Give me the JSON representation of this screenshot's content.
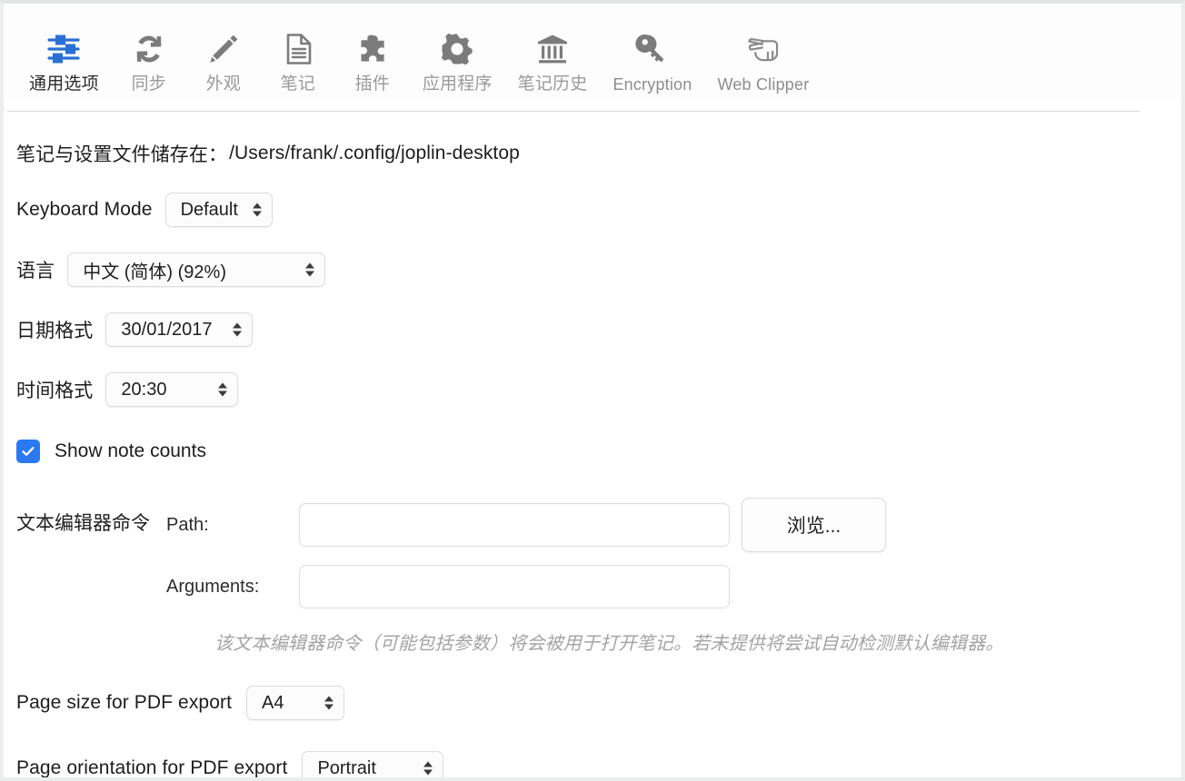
{
  "tabs": [
    {
      "label": "通用选项",
      "icon": "sliders-icon",
      "active": true,
      "latin": false
    },
    {
      "label": "同步",
      "icon": "sync-icon",
      "active": false,
      "latin": false
    },
    {
      "label": "外观",
      "icon": "pencil-icon",
      "active": false,
      "latin": false
    },
    {
      "label": "笔记",
      "icon": "note-icon",
      "active": false,
      "latin": false
    },
    {
      "label": "插件",
      "icon": "puzzle-icon",
      "active": false,
      "latin": false
    },
    {
      "label": "应用程序",
      "icon": "gear-icon",
      "active": false,
      "latin": false
    },
    {
      "label": "笔记历史",
      "icon": "bank-icon",
      "active": false,
      "latin": false
    },
    {
      "label": "Encryption",
      "icon": "key-icon",
      "active": false,
      "latin": true
    },
    {
      "label": "Web Clipper",
      "icon": "hand-scissors-icon",
      "active": false,
      "latin": true
    }
  ],
  "storage": {
    "label": "笔记与设置文件储存在：",
    "path": "/Users/frank/.config/joplin-desktop"
  },
  "settings": {
    "keyboard_mode": {
      "label": "Keyboard Mode",
      "value": "Default"
    },
    "language": {
      "label": "语言",
      "value": "中文 (简体) (92%)"
    },
    "date_format": {
      "label": "日期格式",
      "value": "30/01/2017"
    },
    "time_format": {
      "label": "时间格式",
      "value": "20:30"
    },
    "show_note_counts": {
      "label": "Show note counts",
      "checked": true
    },
    "pdf_page_size": {
      "label": "Page size for PDF export",
      "value": "A4"
    },
    "pdf_page_orientation": {
      "label": "Page orientation for PDF export",
      "value": "Portrait"
    }
  },
  "editor_command": {
    "label": "文本编辑器命令",
    "path_label": "Path:",
    "path_value": "",
    "path_placeholder": "",
    "arguments_label": "Arguments:",
    "arguments_value": "",
    "arguments_placeholder": "",
    "browse_label": "浏览...",
    "help": "该文本编辑器命令（可能包括参数）将会被用于打开笔记。若未提供将尝试自动检测默认编辑器。"
  },
  "colors": {
    "accent_blue": "#2a79f3",
    "icon_gray": "#7b7b7b",
    "active_tab_text": "#2b2b2b",
    "inactive_tab_text": "#9a9a9a",
    "help_text": "#a3a3a3"
  }
}
